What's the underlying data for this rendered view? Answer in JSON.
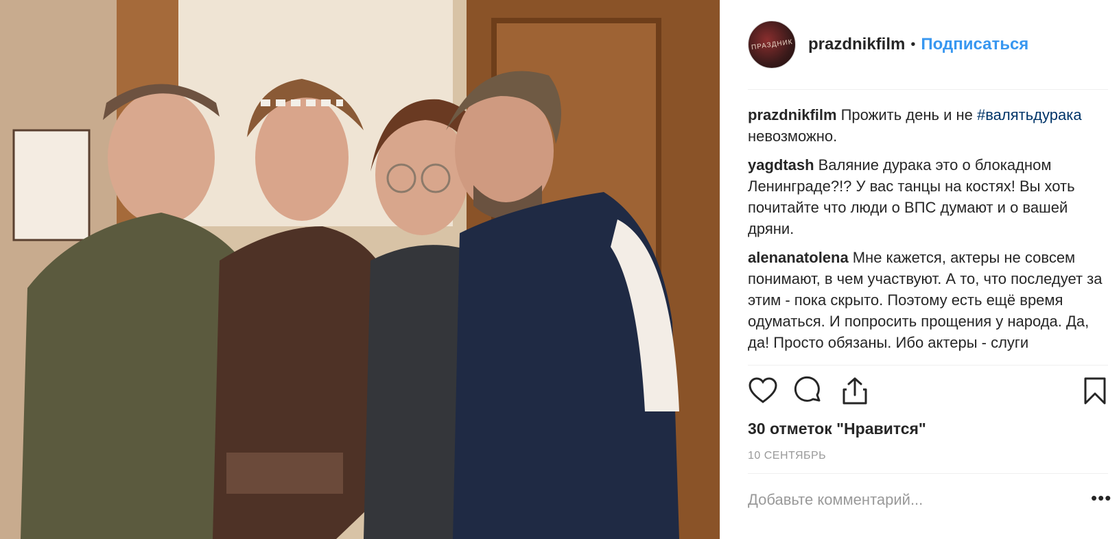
{
  "post": {
    "username": "prazdnikfilm",
    "follow_label": "Подписаться",
    "separator": "•"
  },
  "comments": [
    {
      "user": "prazdnikfilm",
      "text_before": "Прожить день и не ",
      "hashtag": "#валятьдурака",
      "text_after": " невозможно."
    },
    {
      "user": "yagdtash",
      "text": "Валяние дурака это о блокадном Ленинграде?!? У вас танцы на костях! Вы хоть почитайте что люди о ВПС думают и о вашей дряни."
    },
    {
      "user": "alenanatolena",
      "text": "Мне кажется, актеры не совсем понимают, в чем участвуют. А то, что последует за этим - пока скрыто. Поэтому есть ещё время одуматься. И попросить прощения у народа. Да, да! Просто обязаны. Ибо актеры - слуги"
    }
  ],
  "actions": {
    "like_icon": "heart-icon",
    "comment_icon": "comment-bubble-icon",
    "share_icon": "share-icon",
    "save_icon": "bookmark-icon"
  },
  "likes_text": "30 отметок \"Нравится\"",
  "date_text": "10 СЕНТЯБРЬ",
  "add_comment_placeholder": "Добавьте комментарий...",
  "more_label": "•••",
  "avatar_text": "ПРАЗДНИК"
}
